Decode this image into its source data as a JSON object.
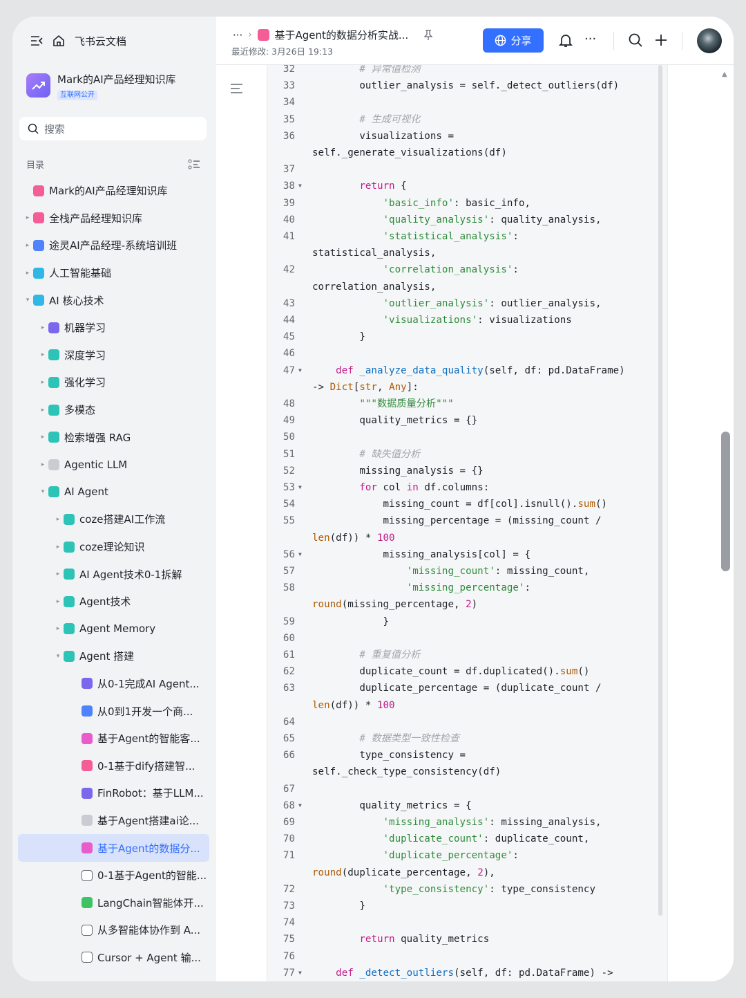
{
  "app": {
    "title": "飞书云文档"
  },
  "kb": {
    "title": "Mark的AI产品经理知识库",
    "badge": "互联网公开"
  },
  "search": {
    "placeholder": "搜索"
  },
  "toc": {
    "label": "目录"
  },
  "tree": [
    {
      "label": "Mark的AI产品经理知识库",
      "indent": 0,
      "arrow": "",
      "icon": "ic-pink"
    },
    {
      "label": "全栈产品经理知识库",
      "indent": 0,
      "arrow": "▸",
      "icon": "ic-pink"
    },
    {
      "label": "途灵AI产品经理-系统培训班",
      "indent": 0,
      "arrow": "▸",
      "icon": "ic-blue"
    },
    {
      "label": "人工智能基础",
      "indent": 0,
      "arrow": "▸",
      "icon": "ic-lblue"
    },
    {
      "label": "AI 核心技术",
      "indent": 0,
      "arrow": "▾",
      "icon": "ic-lblue"
    },
    {
      "label": "机器学习",
      "indent": 1,
      "arrow": "▸",
      "icon": "ic-purple"
    },
    {
      "label": "深度学习",
      "indent": 1,
      "arrow": "▸",
      "icon": "ic-teal"
    },
    {
      "label": "强化学习",
      "indent": 1,
      "arrow": "▸",
      "icon": "ic-teal"
    },
    {
      "label": "多模态",
      "indent": 1,
      "arrow": "▸",
      "icon": "ic-teal"
    },
    {
      "label": "检索增强 RAG",
      "indent": 1,
      "arrow": "▸",
      "icon": "ic-teal"
    },
    {
      "label": "Agentic LLM",
      "indent": 1,
      "arrow": "▸",
      "icon": "ic-gray"
    },
    {
      "label": "AI Agent",
      "indent": 1,
      "arrow": "▾",
      "icon": "ic-teal"
    },
    {
      "label": "coze搭建AI工作流",
      "indent": 2,
      "arrow": "▸",
      "icon": "ic-teal"
    },
    {
      "label": "coze理论知识",
      "indent": 2,
      "arrow": "▸",
      "icon": "ic-teal"
    },
    {
      "label": "AI Agent技术0-1拆解",
      "indent": 2,
      "arrow": "▸",
      "icon": "ic-teal"
    },
    {
      "label": "Agent技术",
      "indent": 2,
      "arrow": "▸",
      "icon": "ic-teal"
    },
    {
      "label": "Agent Memory",
      "indent": 2,
      "arrow": "▸",
      "icon": "ic-teal"
    },
    {
      "label": "Agent 搭建",
      "indent": 2,
      "arrow": "▾",
      "icon": "ic-teal"
    },
    {
      "label": "从0-1完成AI Agent...",
      "indent": 3,
      "arrow": "",
      "icon": "ic-purple"
    },
    {
      "label": "从0到1开发一个商...",
      "indent": 3,
      "arrow": "",
      "icon": "ic-blue"
    },
    {
      "label": "基于Agent的智能客...",
      "indent": 3,
      "arrow": "",
      "icon": "ic-magenta"
    },
    {
      "label": "0-1基于dify搭建智...",
      "indent": 3,
      "arrow": "",
      "icon": "ic-pink"
    },
    {
      "label": "FinRobot：基于LLM...",
      "indent": 3,
      "arrow": "",
      "icon": "ic-purple"
    },
    {
      "label": "基于Agent搭建ai论...",
      "indent": 3,
      "arrow": "",
      "icon": "ic-gray"
    },
    {
      "label": "基于Agent的数据分...",
      "indent": 3,
      "arrow": "",
      "icon": "ic-magenta",
      "selected": true
    },
    {
      "label": "0-1基于Agent的智能...",
      "indent": 3,
      "arrow": "",
      "icon": "ic-doc"
    },
    {
      "label": "LangChain智能体开...",
      "indent": 3,
      "arrow": "",
      "icon": "ic-green"
    },
    {
      "label": "从多智能体协作到 A...",
      "indent": 3,
      "arrow": "",
      "icon": "ic-doc"
    },
    {
      "label": "Cursor + Agent 输...",
      "indent": 3,
      "arrow": "",
      "icon": "ic-doc"
    }
  ],
  "header": {
    "breadcrumb_more": "···",
    "doc_title": "基于Agent的数据分析实战...",
    "modified": "最近修改: 3月26日 19:13",
    "share_label": "分享",
    "more": "···"
  },
  "code": [
    {
      "n": "32",
      "t": [
        [
          "cm",
          "        # 异常值检测"
        ]
      ]
    },
    {
      "n": "33",
      "t": [
        [
          "",
          "        outlier_analysis = self._detect_outliers(df)"
        ]
      ]
    },
    {
      "n": "34",
      "t": []
    },
    {
      "n": "35",
      "t": [
        [
          "cm",
          "        # 生成可视化"
        ]
      ]
    },
    {
      "n": "36",
      "t": [
        [
          "",
          "        visualizations ="
        ]
      ]
    },
    {
      "n": "",
      "t": [
        [
          "",
          "self._generate_visualizations(df)"
        ]
      ]
    },
    {
      "n": "37",
      "t": []
    },
    {
      "n": "38",
      "f": 1,
      "t": [
        [
          "",
          "        "
        ],
        [
          "kw",
          "return"
        ],
        [
          "",
          " {"
        ]
      ]
    },
    {
      "n": "39",
      "t": [
        [
          "",
          "            "
        ],
        [
          "st",
          "'basic_info'"
        ],
        [
          "",
          ": basic_info,"
        ]
      ]
    },
    {
      "n": "40",
      "t": [
        [
          "",
          "            "
        ],
        [
          "st",
          "'quality_analysis'"
        ],
        [
          "",
          ": quality_analysis,"
        ]
      ]
    },
    {
      "n": "41",
      "t": [
        [
          "",
          "            "
        ],
        [
          "st",
          "'statistical_analysis'"
        ],
        [
          "",
          ":"
        ]
      ]
    },
    {
      "n": "",
      "t": [
        [
          "",
          "statistical_analysis,"
        ]
      ]
    },
    {
      "n": "42",
      "t": [
        [
          "",
          "            "
        ],
        [
          "st",
          "'correlation_analysis'"
        ],
        [
          "",
          ":"
        ]
      ]
    },
    {
      "n": "",
      "t": [
        [
          "",
          "correlation_analysis,"
        ]
      ]
    },
    {
      "n": "43",
      "t": [
        [
          "",
          "            "
        ],
        [
          "st",
          "'outlier_analysis'"
        ],
        [
          "",
          ": outlier_analysis,"
        ]
      ]
    },
    {
      "n": "44",
      "t": [
        [
          "",
          "            "
        ],
        [
          "st",
          "'visualizations'"
        ],
        [
          "",
          ": visualizations"
        ]
      ]
    },
    {
      "n": "45",
      "t": [
        [
          "",
          "        }"
        ]
      ]
    },
    {
      "n": "46",
      "t": []
    },
    {
      "n": "47",
      "f": 1,
      "t": [
        [
          "",
          "    "
        ],
        [
          "kw",
          "def"
        ],
        [
          "",
          " "
        ],
        [
          "fn",
          "_analyze_data_quality"
        ],
        [
          "",
          "(self, df: pd.DataFrame)"
        ]
      ]
    },
    {
      "n": "",
      "t": [
        [
          "",
          "-> "
        ],
        [
          "bi",
          "Dict"
        ],
        [
          "",
          "["
        ],
        [
          "bi",
          "str"
        ],
        [
          "",
          ", "
        ],
        [
          "bi",
          "Any"
        ],
        [
          "",
          "]:"
        ]
      ]
    },
    {
      "n": "48",
      "t": [
        [
          "",
          "        "
        ],
        [
          "st",
          "\"\"\"数据质量分析\"\"\""
        ]
      ]
    },
    {
      "n": "49",
      "t": [
        [
          "",
          "        quality_metrics = {}"
        ]
      ]
    },
    {
      "n": "50",
      "t": []
    },
    {
      "n": "51",
      "t": [
        [
          "cm",
          "        # 缺失值分析"
        ]
      ]
    },
    {
      "n": "52",
      "t": [
        [
          "",
          "        missing_analysis = {}"
        ]
      ]
    },
    {
      "n": "53",
      "f": 1,
      "t": [
        [
          "",
          "        "
        ],
        [
          "kw",
          "for"
        ],
        [
          "",
          " col "
        ],
        [
          "kw",
          "in"
        ],
        [
          "",
          " df.columns:"
        ]
      ]
    },
    {
      "n": "54",
      "t": [
        [
          "",
          "            missing_count = df[col].isnull()."
        ],
        [
          "bi",
          "sum"
        ],
        [
          "",
          "()"
        ]
      ]
    },
    {
      "n": "55",
      "t": [
        [
          "",
          "            missing_percentage = (missing_count /"
        ]
      ]
    },
    {
      "n": "",
      "t": [
        [
          "bi",
          "len"
        ],
        [
          "",
          "(df)) * "
        ],
        [
          "nm",
          "100"
        ]
      ]
    },
    {
      "n": "56",
      "f": 1,
      "t": [
        [
          "",
          "            missing_analysis[col] = {"
        ]
      ]
    },
    {
      "n": "57",
      "t": [
        [
          "",
          "                "
        ],
        [
          "st",
          "'missing_count'"
        ],
        [
          "",
          ": missing_count,"
        ]
      ]
    },
    {
      "n": "58",
      "t": [
        [
          "",
          "                "
        ],
        [
          "st",
          "'missing_percentage'"
        ],
        [
          "",
          ":"
        ]
      ]
    },
    {
      "n": "",
      "t": [
        [
          "bi",
          "round"
        ],
        [
          "",
          "(missing_percentage, "
        ],
        [
          "nm",
          "2"
        ],
        [
          "",
          ")"
        ]
      ]
    },
    {
      "n": "59",
      "t": [
        [
          "",
          "            }"
        ]
      ]
    },
    {
      "n": "60",
      "t": []
    },
    {
      "n": "61",
      "t": [
        [
          "cm",
          "        # 重复值分析"
        ]
      ]
    },
    {
      "n": "62",
      "t": [
        [
          "",
          "        duplicate_count = df.duplicated()."
        ],
        [
          "bi",
          "sum"
        ],
        [
          "",
          "()"
        ]
      ]
    },
    {
      "n": "63",
      "t": [
        [
          "",
          "        duplicate_percentage = (duplicate_count /"
        ]
      ]
    },
    {
      "n": "",
      "t": [
        [
          "bi",
          "len"
        ],
        [
          "",
          "(df)) * "
        ],
        [
          "nm",
          "100"
        ]
      ]
    },
    {
      "n": "64",
      "t": []
    },
    {
      "n": "65",
      "t": [
        [
          "cm",
          "        # 数据类型一致性检查"
        ]
      ]
    },
    {
      "n": "66",
      "t": [
        [
          "",
          "        type_consistency ="
        ]
      ]
    },
    {
      "n": "",
      "t": [
        [
          "",
          "self._check_type_consistency(df)"
        ]
      ]
    },
    {
      "n": "67",
      "t": []
    },
    {
      "n": "68",
      "f": 1,
      "t": [
        [
          "",
          "        quality_metrics = {"
        ]
      ]
    },
    {
      "n": "69",
      "t": [
        [
          "",
          "            "
        ],
        [
          "st",
          "'missing_analysis'"
        ],
        [
          "",
          ": missing_analysis,"
        ]
      ]
    },
    {
      "n": "70",
      "t": [
        [
          "",
          "            "
        ],
        [
          "st",
          "'duplicate_count'"
        ],
        [
          "",
          ": duplicate_count,"
        ]
      ]
    },
    {
      "n": "71",
      "t": [
        [
          "",
          "            "
        ],
        [
          "st",
          "'duplicate_percentage'"
        ],
        [
          "",
          ":"
        ]
      ]
    },
    {
      "n": "",
      "t": [
        [
          "bi",
          "round"
        ],
        [
          "",
          "(duplicate_percentage, "
        ],
        [
          "nm",
          "2"
        ],
        [
          "",
          "),"
        ]
      ]
    },
    {
      "n": "72",
      "t": [
        [
          "",
          "            "
        ],
        [
          "st",
          "'type_consistency'"
        ],
        [
          "",
          ": type_consistency"
        ]
      ]
    },
    {
      "n": "73",
      "t": [
        [
          "",
          "        }"
        ]
      ]
    },
    {
      "n": "74",
      "t": []
    },
    {
      "n": "75",
      "t": [
        [
          "",
          "        "
        ],
        [
          "kw",
          "return"
        ],
        [
          "",
          " quality_metrics"
        ]
      ]
    },
    {
      "n": "76",
      "t": []
    },
    {
      "n": "77",
      "f": 1,
      "t": [
        [
          "",
          "    "
        ],
        [
          "kw",
          "def"
        ],
        [
          "",
          " "
        ],
        [
          "fn",
          "_detect_outliers"
        ],
        [
          "",
          "(self, df: pd.DataFrame) ->"
        ]
      ]
    }
  ]
}
